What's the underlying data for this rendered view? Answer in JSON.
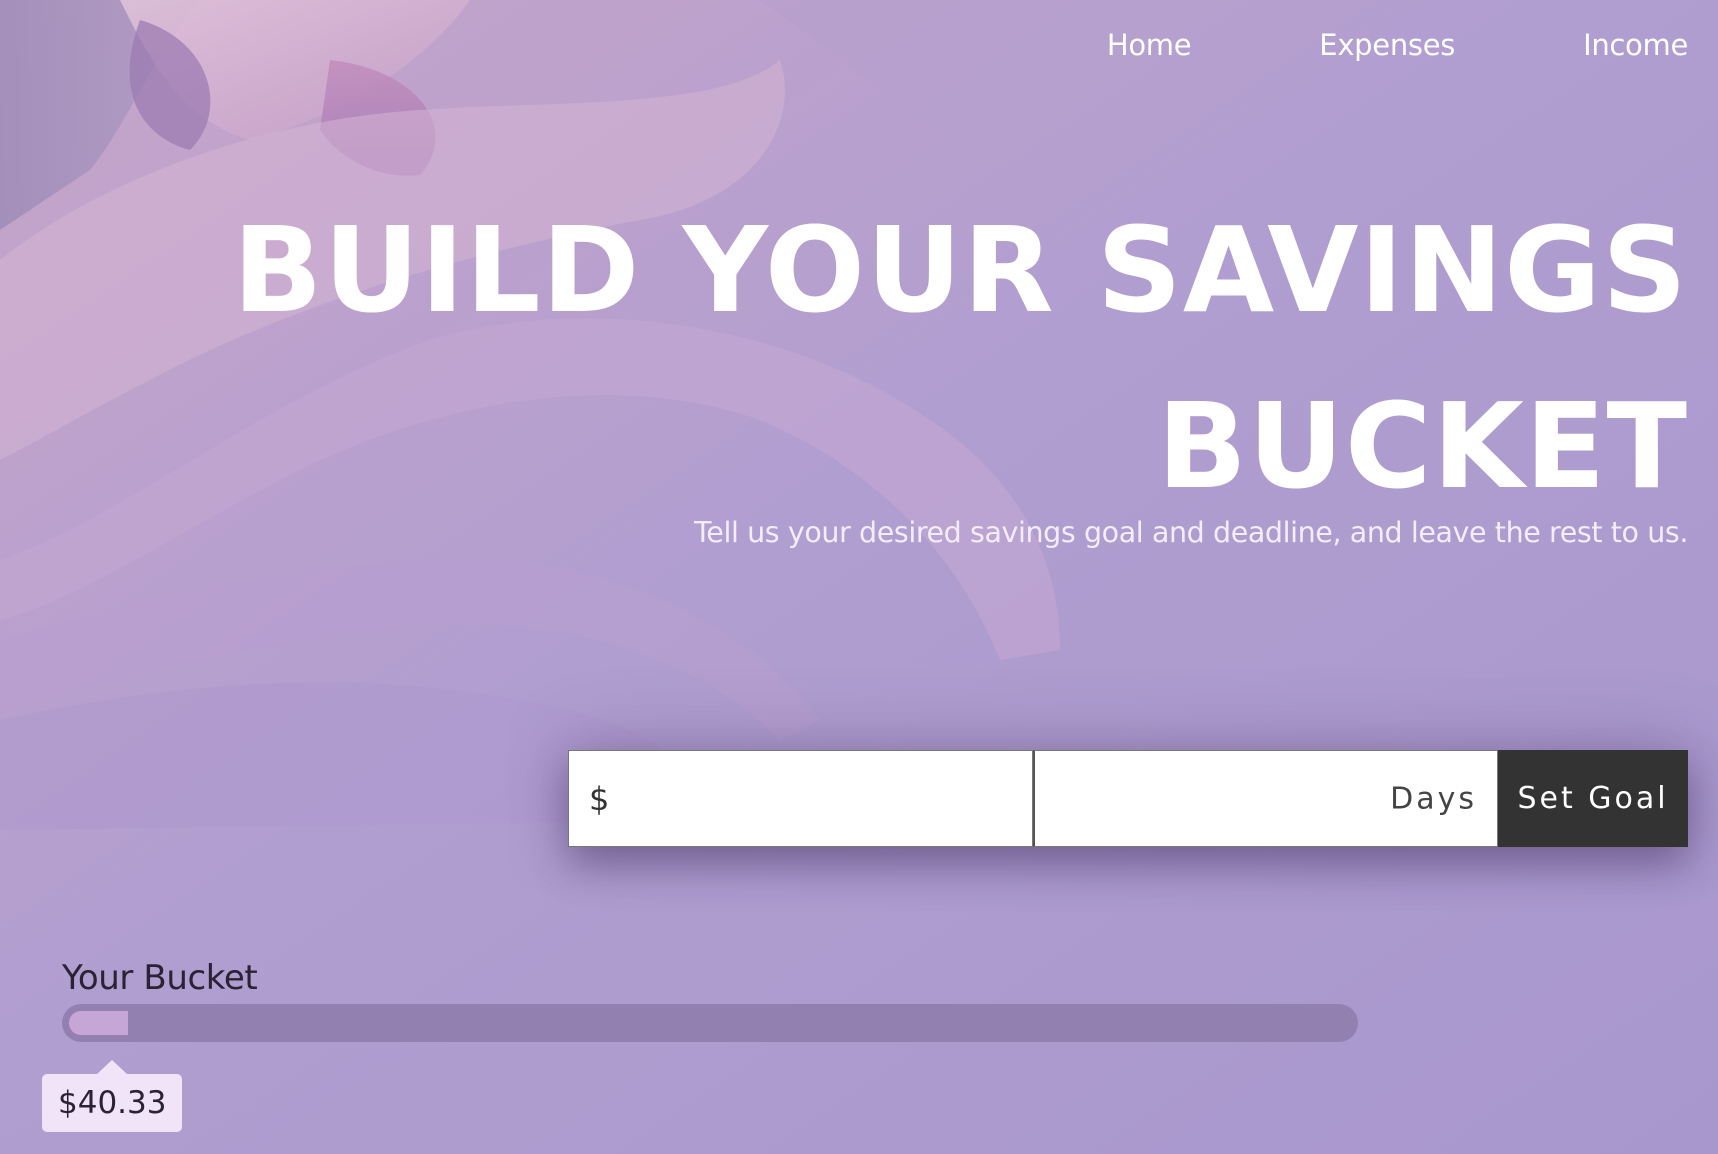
{
  "nav": {
    "items": [
      {
        "label": "Home"
      },
      {
        "label": "Expenses"
      },
      {
        "label": "Income"
      }
    ]
  },
  "hero": {
    "title": "BUILD YOUR SAVINGS BUCKET",
    "subtitle": "Tell us your desired savings goal and deadline, and leave the rest to us."
  },
  "goal_form": {
    "amount_prefix": "$",
    "amount_value": "",
    "days_value": "",
    "days_suffix": "Days",
    "submit_label": "Set Goal"
  },
  "bucket": {
    "label": "Your Bucket",
    "amount": "$40.33",
    "progress_fraction": 0.046
  },
  "colors": {
    "background": "#ab9bcf",
    "accent_dark": "#333333",
    "bucket_track": "#9280b0",
    "bucket_fill": "#c6a6d7",
    "tooltip": "#f1e4f8"
  }
}
